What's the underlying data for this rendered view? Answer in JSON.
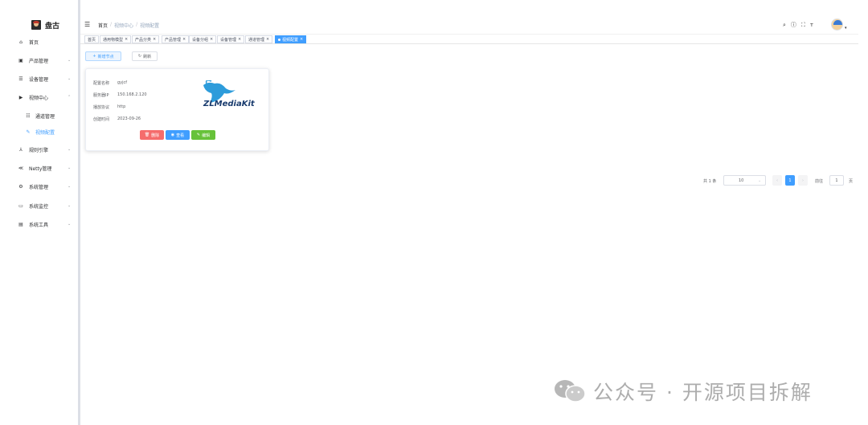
{
  "app": {
    "title": "盘古"
  },
  "sidebar": {
    "items": [
      {
        "label": "首页",
        "icon": "home-icon",
        "glyph": "⌂",
        "has_arrow": false
      },
      {
        "label": "产品管理",
        "icon": "chip-icon",
        "glyph": "▣",
        "has_arrow": true
      },
      {
        "label": "设备管理",
        "icon": "list-icon",
        "glyph": "☰",
        "has_arrow": true
      },
      {
        "label": "视频中心",
        "icon": "video-icon",
        "glyph": "▶",
        "has_arrow": true,
        "expanded": true
      },
      {
        "label": "通道管理",
        "icon": "settings-list-icon",
        "glyph": "☷",
        "sub": true
      },
      {
        "label": "视频配置",
        "icon": "edit-icon",
        "glyph": "✎",
        "sub": true,
        "active": true
      },
      {
        "label": "规则引擎",
        "icon": "flow-icon",
        "glyph": "⅄",
        "has_arrow": true
      },
      {
        "label": "Netty管理",
        "icon": "network-icon",
        "glyph": "≪",
        "has_arrow": true
      },
      {
        "label": "系统管理",
        "icon": "gear-icon",
        "glyph": "⚙",
        "has_arrow": true
      },
      {
        "label": "系统监控",
        "icon": "monitor-icon",
        "glyph": "▭",
        "has_arrow": true
      },
      {
        "label": "系统工具",
        "icon": "tools-icon",
        "glyph": "▤",
        "has_arrow": true
      }
    ]
  },
  "breadcrumb": [
    "首页",
    "视频中心",
    "视频配置"
  ],
  "tags": [
    {
      "label": "首页",
      "closable": false
    },
    {
      "label": "通用物模型",
      "closable": true
    },
    {
      "label": "产品分类",
      "closable": true
    },
    {
      "label": "产品管理",
      "closable": true
    },
    {
      "label": "设备分组",
      "closable": true
    },
    {
      "label": "设备管理",
      "closable": true
    },
    {
      "label": "通道管理",
      "closable": true
    },
    {
      "label": "视频配置",
      "closable": true,
      "active": true
    }
  ],
  "toolbar": {
    "add_label": "新增节点",
    "refresh_label": "刷新"
  },
  "card": {
    "fields": [
      {
        "label": "配置名称",
        "value": "gyjcf"
      },
      {
        "label": "服务器IP",
        "value": "150.168.2.120"
      },
      {
        "label": "播放协议",
        "value": "http"
      },
      {
        "label": "创建时间",
        "value": "2023-09-26"
      }
    ],
    "logo_text": "ZLMediaKit",
    "delete_label": "删除",
    "view_label": "查看",
    "edit_label": "编辑"
  },
  "pagination": {
    "total_text": "共 1 条",
    "page_size": "10",
    "current_page": "1",
    "goto_label": "前往",
    "goto_value": "1",
    "unit": "页"
  },
  "watermark": {
    "text": "公众号 · 开源项目拆解"
  },
  "colors": {
    "primary": "#409eff",
    "danger": "#f56c6c",
    "success": "#67c23a"
  }
}
